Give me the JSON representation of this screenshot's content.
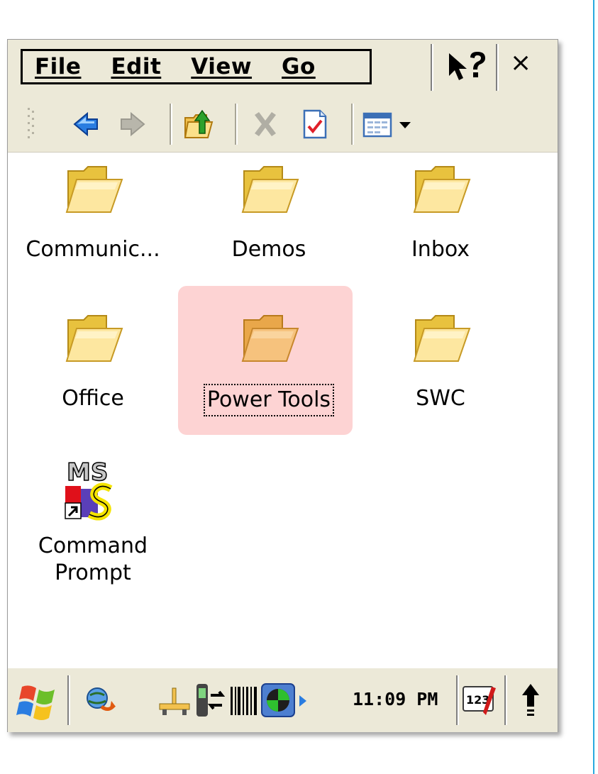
{
  "menubar": {
    "items": [
      {
        "label": "File"
      },
      {
        "label": "Edit"
      },
      {
        "label": "View"
      },
      {
        "label": "Go"
      }
    ],
    "help_icon": "help-pointer-icon",
    "close_label": "×"
  },
  "toolbar": {
    "buttons": [
      "back-arrow-icon",
      "forward-arrow-icon",
      "up-folder-icon",
      "delete-icon",
      "properties-icon",
      "view-list-icon",
      "view-dropdown-icon"
    ]
  },
  "files": [
    {
      "label": "Communic...",
      "icon": "folder-icon"
    },
    {
      "label": "Demos",
      "icon": "folder-icon"
    },
    {
      "label": "Inbox",
      "icon": "folder-icon"
    },
    {
      "label": "Office",
      "icon": "folder-icon"
    },
    {
      "label": "Power Tools",
      "icon": "folder-icon",
      "selected": true
    },
    {
      "label": "SWC",
      "icon": "folder-icon"
    },
    {
      "label_line1": "Command",
      "label_line2": "Prompt",
      "icon": "msdos-shortcut-icon"
    }
  ],
  "taskbar": {
    "clock": "11:09 PM",
    "colors": {
      "selection": "#fdd3d3",
      "chrome": "#ece9d8"
    }
  }
}
